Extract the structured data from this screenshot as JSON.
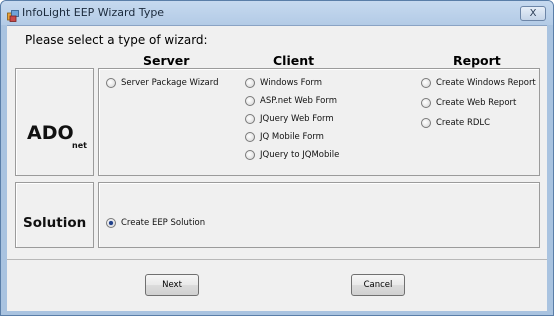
{
  "window": {
    "title": "InfoLight EEP Wizard Type",
    "close_glyph": "X"
  },
  "prompt": "Please select a type of wizard:",
  "headers": {
    "server": "Server",
    "client": "Client",
    "report": "Report"
  },
  "ado": {
    "main": "ADO",
    "sub": "net"
  },
  "solution_label": "Solution",
  "server_options": [
    {
      "label": "Server Package Wizard",
      "checked": false
    }
  ],
  "client_options": [
    {
      "label": "Windows Form",
      "checked": false
    },
    {
      "label": "ASP.net Web Form",
      "checked": false
    },
    {
      "label": "JQuery Web Form",
      "checked": false
    },
    {
      "label": "JQ Mobile Form",
      "checked": false
    },
    {
      "label": "JQuery to JQMobile",
      "checked": false
    }
  ],
  "report_options": [
    {
      "label": "Create Windows Report",
      "checked": false
    },
    {
      "label": "Create Web Report",
      "checked": false
    },
    {
      "label": "Create RDLC",
      "checked": false
    }
  ],
  "solution_options": [
    {
      "label": "Create EEP Solution",
      "checked": true
    }
  ],
  "buttons": {
    "next": "Next",
    "cancel": "Cancel"
  },
  "icons": {
    "title_icon": "app-wizard-icon",
    "close_icon": "close-icon",
    "radio_icon": "radio-button-icon"
  }
}
